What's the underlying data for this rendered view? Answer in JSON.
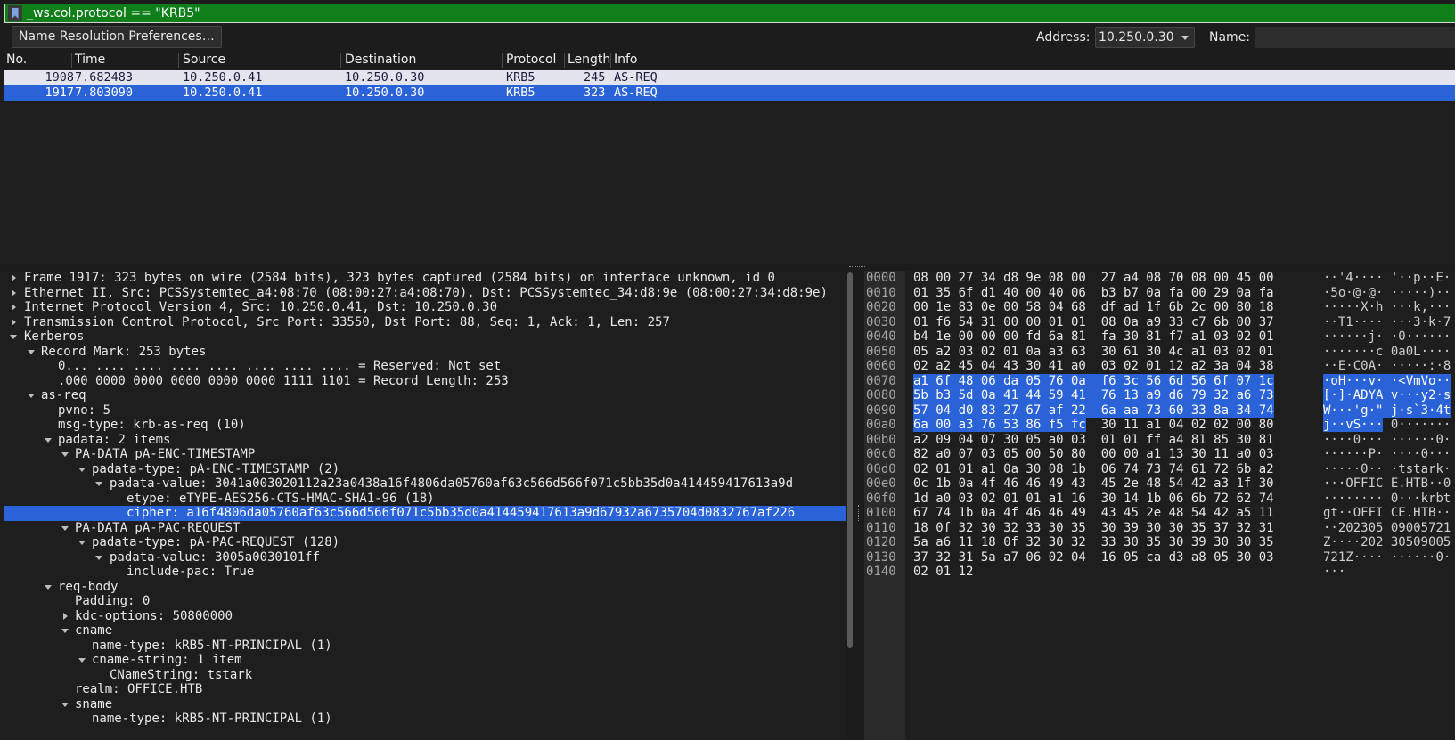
{
  "filter": {
    "value": "_ws.col.protocol == \"KRB5\""
  },
  "resolution": {
    "button_label": "Name Resolution Preferences…",
    "address_label": "Address:",
    "address_value": "10.250.0.30",
    "name_label": "Name:"
  },
  "packet_list": {
    "columns": [
      "No.",
      "Time",
      "Source",
      "Destination",
      "Protocol",
      "Length",
      "Info"
    ],
    "rows": [
      {
        "no": "1908",
        "time": "7.682483",
        "source": "10.250.0.41",
        "destination": "10.250.0.30",
        "protocol": "KRB5",
        "length": "245",
        "info": "AS-REQ"
      },
      {
        "no": "1917",
        "time": "7.803090",
        "source": "10.250.0.41",
        "destination": "10.250.0.30",
        "protocol": "KRB5",
        "length": "323",
        "info": "AS-REQ"
      }
    ]
  },
  "tree": [
    "Frame 1917: 323 bytes on wire (2584 bits), 323 bytes captured (2584 bits) on interface unknown, id 0",
    "Ethernet II, Src: PCSSystemtec_a4:08:70 (08:00:27:a4:08:70), Dst: PCSSystemtec_34:d8:9e (08:00:27:34:d8:9e)",
    "Internet Protocol Version 4, Src: 10.250.0.41, Dst: 10.250.0.30",
    "Transmission Control Protocol, Src Port: 33550, Dst Port: 88, Seq: 1, Ack: 1, Len: 257",
    "Kerberos",
    "Record Mark: 253 bytes",
    "0... .... .... .... .... .... .... .... = Reserved: Not set",
    ".000 0000 0000 0000 0000 0000 1111 1101 = Record Length: 253",
    "as-req",
    "pvno: 5",
    "msg-type: krb-as-req (10)",
    "padata: 2 items",
    "PA-DATA pA-ENC-TIMESTAMP",
    "padata-type: pA-ENC-TIMESTAMP (2)",
    "padata-value: 3041a003020112a23a0438a16f4806da05760af63c566d566f071c5bb35d0a414459417613a9d",
    "etype: eTYPE-AES256-CTS-HMAC-SHA1-96 (18)",
    "cipher: a16f4806da05760af63c566d566f071c5bb35d0a414459417613a9d67932a6735704d0832767af226",
    "PA-DATA pA-PAC-REQUEST",
    "padata-type: pA-PAC-REQUEST (128)",
    "padata-value: 3005a0030101ff",
    "include-pac: True",
    "req-body",
    "Padding: 0",
    "kdc-options: 50800000",
    "cname",
    "name-type: kRB5-NT-PRINCIPAL (1)",
    "cname-string: 1 item",
    "CNameString: tstark",
    "realm: OFFICE.HTB",
    "sname",
    "name-type: kRB5-NT-PRINCIPAL (1)"
  ],
  "hex": [
    {
      "off": "0000",
      "b1": "08 00 27 34 d8 9e 08 00",
      "b2": "27 a4 08 70 08 00 45 00",
      "a1": "··'4····",
      "a2": "'··p··E·"
    },
    {
      "off": "0010",
      "b1": "01 35 6f d1 40 00 40 06",
      "b2": "b3 b7 0a fa 00 29 0a fa",
      "a1": "·5o·@·@·",
      "a2": "·····)··"
    },
    {
      "off": "0020",
      "b1": "00 1e 83 0e 00 58 04 68",
      "b2": "df ad 1f 6b 2c 00 80 18",
      "a1": "·····X·h",
      "a2": "···k,···"
    },
    {
      "off": "0030",
      "b1": "01 f6 54 31 00 00 01 01",
      "b2": "08 0a a9 33 c7 6b 00 37",
      "a1": "··T1····",
      "a2": "···3·k·7"
    },
    {
      "off": "0040",
      "b1": "b4 1e 00 00 00 fd 6a 81",
      "b2": "fa 30 81 f7 a1 03 02 01",
      "a1": "······j·",
      "a2": "·0······"
    },
    {
      "off": "0050",
      "b1": "05 a2 03 02 01 0a a3 63",
      "b2": "30 61 30 4c a1 03 02 01",
      "a1": "·······c",
      "a2": "0a0L····"
    },
    {
      "off": "0060",
      "b1": "02 a2 45 04 43 30 41 a0",
      "b2": "03 02 01 12 a2 3a 04 38",
      "a1": "··E·C0A·",
      "a2": "·····:·8"
    },
    {
      "off": "0070",
      "b1": "a1 6f 48 06 da 05 76 0a",
      "b2": "f6 3c 56 6d 56 6f 07 1c",
      "a1": "·oH···v·",
      "a2": "·<VmVo··"
    },
    {
      "off": "0080",
      "b1": "5b b3 5d 0a 41 44 59 41",
      "b2": "76 13 a9 d6 79 32 a6 73",
      "a1": "[·]·ADYA",
      "a2": "v···y2·s"
    },
    {
      "off": "0090",
      "b1": "57 04 d0 83 27 67 af 22",
      "b2": "6a aa 73 60 33 8a 34 74",
      "a1": "W···'g·\"",
      "a2": "j·s`3·4t"
    },
    {
      "off": "00a0",
      "b1": "6a 00 a3 76 53 86 f5 fc",
      "b2": "30 11 a1 04 02 02 00 80",
      "a1": "j··vS···",
      "a2": "0·······"
    },
    {
      "off": "00b0",
      "b1": "a2 09 04 07 30 05 a0 03",
      "b2": "01 01 ff a4 81 85 30 81",
      "a1": "····0···",
      "a2": "······0·"
    },
    {
      "off": "00c0",
      "b1": "82 a0 07 03 05 00 50 80",
      "b2": "00 00 a1 13 30 11 a0 03",
      "a1": "······P·",
      "a2": "····0···"
    },
    {
      "off": "00d0",
      "b1": "02 01 01 a1 0a 30 08 1b",
      "b2": "06 74 73 74 61 72 6b a2",
      "a1": "·····0··",
      "a2": "·tstark·"
    },
    {
      "off": "00e0",
      "b1": "0c 1b 0a 4f 46 46 49 43",
      "b2": "45 2e 48 54 42 a3 1f 30",
      "a1": "···OFFIC",
      "a2": "E.HTB··0"
    },
    {
      "off": "00f0",
      "b1": "1d a0 03 02 01 01 a1 16",
      "b2": "30 14 1b 06 6b 72 62 74",
      "a1": "········",
      "a2": "0···krbt"
    },
    {
      "off": "0100",
      "b1": "67 74 1b 0a 4f 46 46 49",
      "b2": "43 45 2e 48 54 42 a5 11",
      "a1": "gt··OFFI",
      "a2": "CE.HTB··"
    },
    {
      "off": "0110",
      "b1": "18 0f 32 30 32 33 30 35",
      "b2": "30 39 30 30 35 37 32 31",
      "a1": "··202305",
      "a2": "09005721"
    },
    {
      "off": "0120",
      "b1": "5a a6 11 18 0f 32 30 32",
      "b2": "33 30 35 30 39 30 30 35",
      "a1": "Z····202",
      "a2": "30509005"
    },
    {
      "off": "0130",
      "b1": "37 32 31 5a a7 06 02 04",
      "b2": "16 05 ca d3 a8 05 30 03",
      "a1": "721Z····",
      "a2": "······0·"
    },
    {
      "off": "0140",
      "b1": "02 01 12",
      "b2": "",
      "a1": "···",
      "a2": ""
    }
  ]
}
